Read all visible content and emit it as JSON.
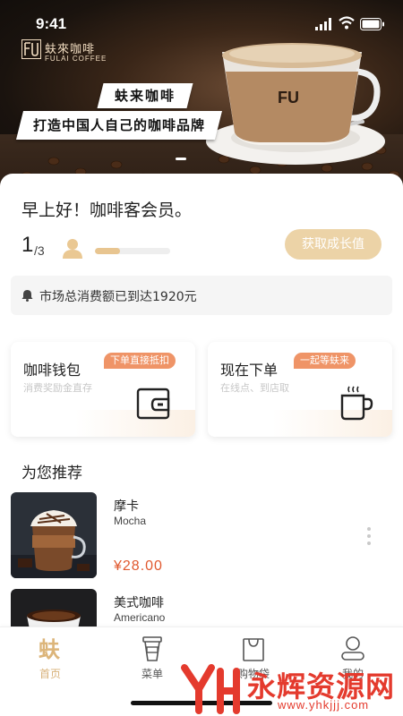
{
  "status_bar": {
    "time": "9:41"
  },
  "brand": {
    "name_cn": "蚨來咖啡",
    "name_en": "FULAI COFFEE",
    "cup_logo": "FU"
  },
  "hero": {
    "banner_line1": "蚨来咖啡",
    "banner_line2": "打造中国人自己的咖啡品牌"
  },
  "member": {
    "greeting": "早上好！咖啡客会员。",
    "progress_current": "1",
    "progress_total": "/3",
    "progress_fraction": 0.33,
    "action_label": "获取成长值"
  },
  "notice": {
    "icon": "bell-icon",
    "text": "市场总消费额已到达1920元"
  },
  "cards": [
    {
      "title": "咖啡钱包",
      "tag": "下单直接抵扣",
      "subtitle": "消费奖励金直存",
      "icon": "wallet-icon"
    },
    {
      "title": "现在下单",
      "tag": "一起等蚨来",
      "subtitle": "在线点、到店取",
      "icon": "coffee-cup-icon"
    }
  ],
  "recommend": {
    "title": "为您推荐",
    "items": [
      {
        "name": "摩卡",
        "name_en": "Mocha",
        "price": "¥28.00"
      },
      {
        "name": "美式咖啡",
        "name_en": "Americano",
        "price": ""
      }
    ]
  },
  "tabbar": {
    "tabs": [
      {
        "label": "首页",
        "icon": "home-logo-icon",
        "active": true
      },
      {
        "label": "菜单",
        "icon": "cup-icon",
        "active": false
      },
      {
        "label": "购物袋",
        "icon": "bag-icon",
        "active": false
      },
      {
        "label": "我的",
        "icon": "person-icon",
        "active": false
      }
    ]
  },
  "watermark": {
    "name": "永辉资源网",
    "url": "www.yhkjjj.com"
  },
  "colors": {
    "accent": "#ecd3a7",
    "tag": "#ef9467",
    "price": "#e0582e",
    "tab_active": "#d8b27a"
  }
}
